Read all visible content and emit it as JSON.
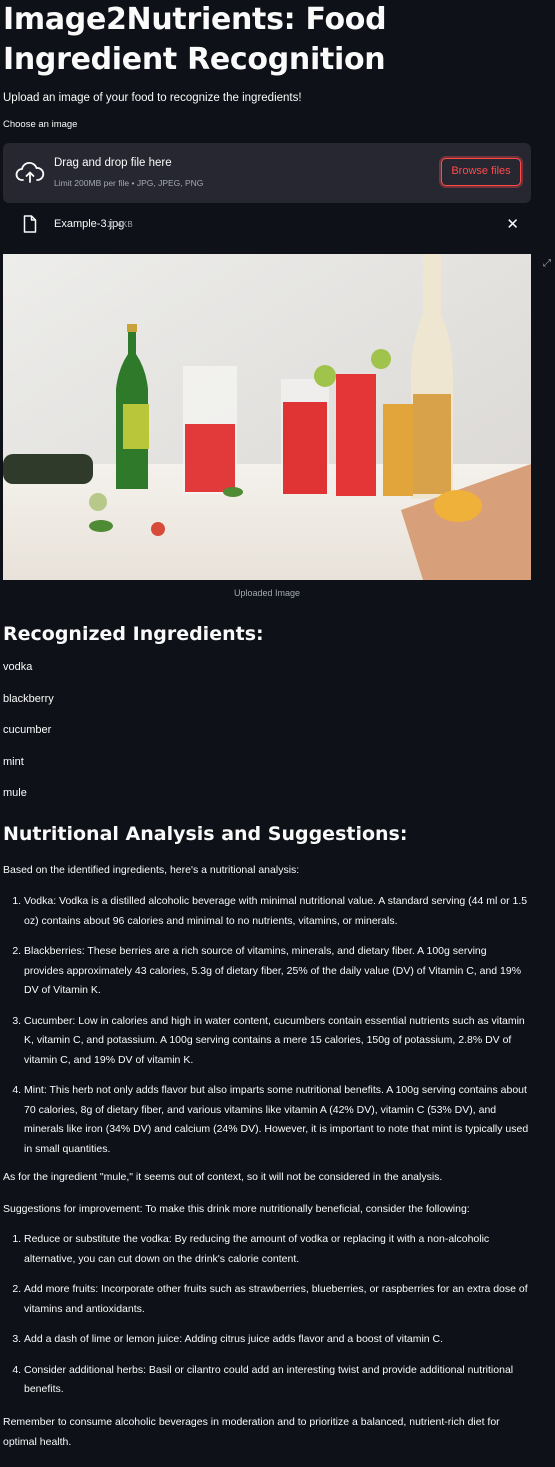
{
  "page": {
    "title": "Image2Nutrients: Food Ingredient Recognition",
    "lead": "Upload an image of your food to recognize the ingredients!"
  },
  "uploader": {
    "label": "Choose an image",
    "dropzone_title": "Drag and drop file here",
    "limit": "Limit 200MB per file • JPG, JPEG, PNG",
    "browse_label": "Browse files",
    "upload_icon": "cloud-upload-icon"
  },
  "file": {
    "name": "Example-3.jpg",
    "size": "11.4KB",
    "file_icon": "file-icon",
    "close_icon": "close-icon"
  },
  "image": {
    "caption": "Uploaded Image"
  },
  "ingredients": {
    "heading": "Recognized Ingredients:",
    "items": [
      "vodka",
      "blackberry",
      "cucumber",
      "mint",
      "mule"
    ]
  },
  "analysis": {
    "heading": "Nutritional Analysis and Suggestions:",
    "intro": "Based on the identified ingredients, here's a nutritional analysis:",
    "items": [
      "Vodka: Vodka is a distilled alcoholic beverage with minimal nutritional value. A standard serving (44 ml or 1.5 oz) contains about 96 calories and minimal to no nutrients, vitamins, or minerals.",
      "Blackberries: These berries are a rich source of vitamins, minerals, and dietary fiber. A 100g serving provides approximately 43 calories, 5.3g of dietary fiber, 25% of the daily value (DV) of Vitamin C, and 19% DV of Vitamin K.",
      "Cucumber: Low in calories and high in water content, cucumbers contain essential nutrients such as vitamin K, vitamin C, and potassium. A 100g serving contains a mere 15 calories, 150g of potassium, 2.8% DV of vitamin C, and 19% DV of vitamin K.",
      "Mint: This herb not only adds flavor but also imparts some nutritional benefits. A 100g serving contains about 70 calories, 8g of dietary fiber, and various vitamins like vitamin A (42% DV), vitamin C (53% DV), and minerals like iron (34% DV) and calcium (24% DV). However, it is important to note that mint is typically used in small quantities."
    ],
    "mule_note": "As for the ingredient \"mule,\" it seems out of context, so it will not be considered in the analysis.",
    "suggestions_intro": "Suggestions for improvement: To make this drink more nutritionally beneficial, consider the following:",
    "suggestions": [
      "Reduce or substitute the vodka: By reducing the amount of vodka or replacing it with a non-alcoholic alternative, you can cut down on the drink's calorie content.",
      "Add more fruits: Incorporate other fruits such as strawberries, blueberries, or raspberries for an extra dose of vitamins and antioxidants.",
      "Add a dash of lime or lemon juice: Adding citrus juice adds flavor and a boost of vitamin C.",
      "Consider additional herbs: Basil or cilantro could add an interesting twist and provide additional nutritional benefits."
    ],
    "closing": "Remember to consume alcoholic beverages in moderation and to prioritize a balanced, nutrient-rich diet for optimal health."
  },
  "colors": {
    "background": "#0e1117",
    "panel": "#262730",
    "accent": "#ff4b4b",
    "muted": "#a3a8b4"
  }
}
